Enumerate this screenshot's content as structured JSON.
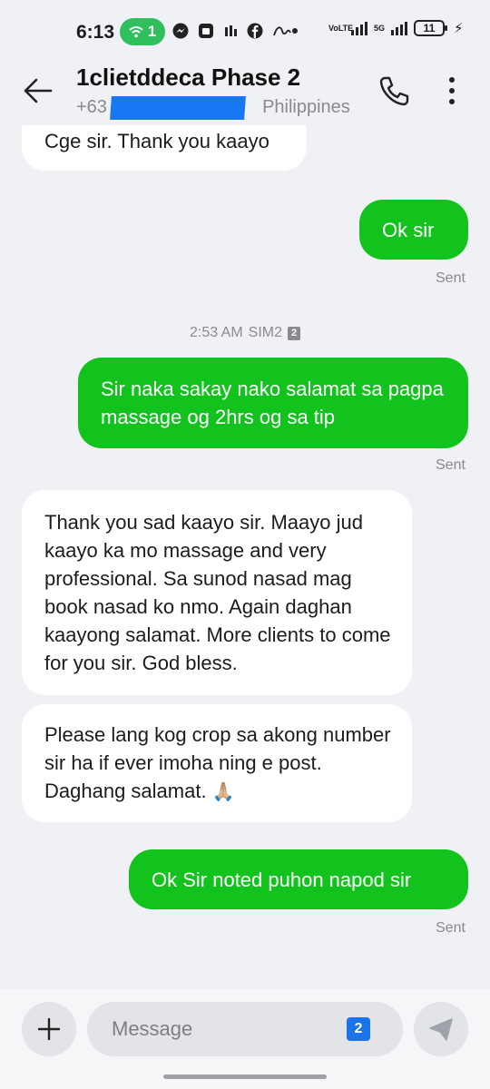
{
  "status_bar": {
    "time": "6:13",
    "hotspot_count": "1",
    "network": "VoLTE",
    "network_type": "5G",
    "battery": "11"
  },
  "header": {
    "contact_name": "1clietddeca Phase 2",
    "phone_prefix": "+63",
    "location": "Philippines"
  },
  "thread": {
    "timestamp": "2:53 AM",
    "sim_label": "SIM2",
    "sim_badge": "2",
    "messages": [
      {
        "direction": "incoming",
        "text": "Cge sir. Thank you kaayo"
      },
      {
        "direction": "outgoing",
        "text": "Ok sir",
        "status": "Sent"
      },
      {
        "direction": "outgoing",
        "text": "Sir naka sakay nako salamat sa pagpa massage og 2hrs og sa tip",
        "status": "Sent"
      },
      {
        "direction": "incoming",
        "text": "Thank you sad kaayo sir. Maayo jud kaayo ka mo massage and very professional. Sa sunod nasad mag book nasad ko nmo. Again daghan kaayong salamat. More clients to come for you sir. God bless."
      },
      {
        "direction": "incoming",
        "text": "Please lang kog crop sa akong number sir ha if ever imoha ning e post. Daghang salamat.",
        "emoji": "🙏🏼"
      },
      {
        "direction": "outgoing",
        "text": "Ok Sir noted puhon napod sir",
        "status": "Sent"
      }
    ]
  },
  "composer": {
    "placeholder": "Message",
    "sim_selector": "2"
  },
  "colors": {
    "outgoing_bubble": "#12c21d",
    "incoming_bubble": "#ffffff",
    "background": "#eff1f4",
    "redaction": "#1877f2"
  },
  "icons": {
    "back": "back-arrow-icon",
    "call": "phone-icon",
    "menu": "more-vertical-icon",
    "add": "plus-icon",
    "send": "send-icon"
  }
}
